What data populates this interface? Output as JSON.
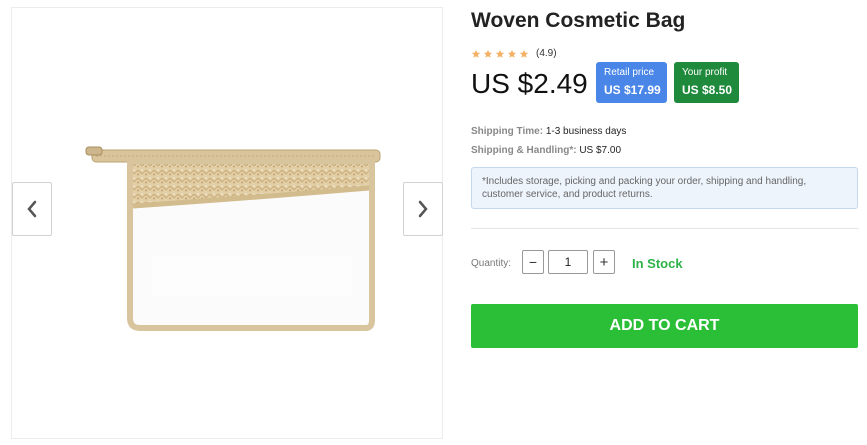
{
  "product": {
    "title": "Woven Cosmetic Bag",
    "rating": "(4.9)",
    "star_count": 5,
    "price": "US $2.49"
  },
  "badges": {
    "retail_label": "Retail price",
    "retail_value": "US $17.99",
    "profit_label": "Your profit",
    "profit_value": "US $8.50"
  },
  "shipping": {
    "time_label": "Shipping Time:",
    "time_value": "1-3 business days",
    "handling_label": "Shipping & Handling*:",
    "handling_value": "US $7.00",
    "note": "*Includes storage, picking and packing your order, shipping and handling, customer service, and product returns."
  },
  "quantity": {
    "label": "Quantity:",
    "value": "1",
    "minus": "−",
    "plus": "+"
  },
  "stock_status": "In Stock",
  "cart_button": "ADD TO CART",
  "icons": {
    "prev": "chevron-left-icon",
    "next": "chevron-right-icon",
    "star": "star-icon"
  },
  "colors": {
    "retail_badge": "#4a86e8",
    "profit_badge": "#1f8a3c",
    "cart_button": "#2bbf38",
    "in_stock": "#2db34a",
    "star": "#f4b267"
  }
}
